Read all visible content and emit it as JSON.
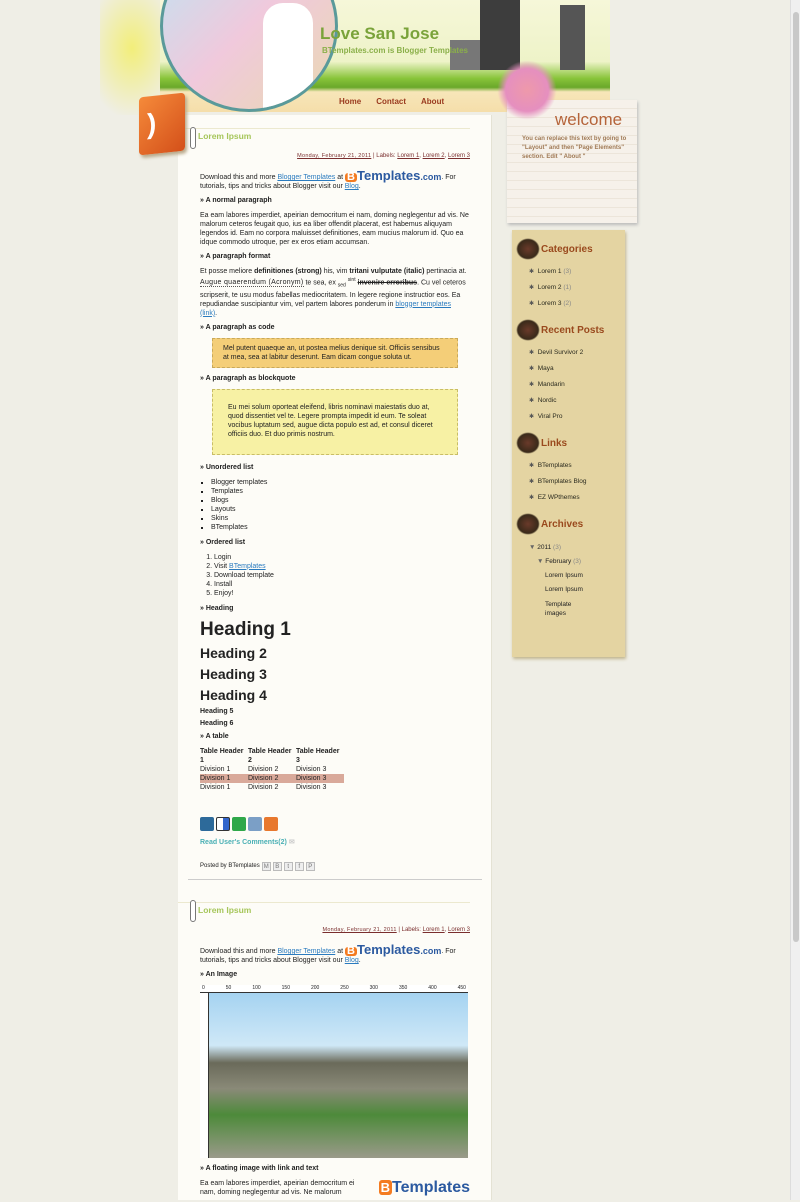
{
  "header": {
    "title": "Love San Jose",
    "description": "BTemplates.com is Blogger Templates",
    "nav": [
      "Home",
      "Contact",
      "About"
    ]
  },
  "welcome": {
    "title": "welcome",
    "text": "You can replace this text by going to \"Layout\" and then \"Page Elements\" section. Edit \" About \""
  },
  "sidebar": {
    "categories": {
      "title": "Categories",
      "items": [
        {
          "label": "Lorem 1",
          "count": "(3)"
        },
        {
          "label": "Lorem 2",
          "count": "(1)"
        },
        {
          "label": "Lorem 3",
          "count": "(2)"
        }
      ]
    },
    "recent": {
      "title": "Recent Posts",
      "items": [
        "Devil Survivor 2",
        "Maya",
        "Mandarin",
        "Nordic",
        "Viral Pro"
      ]
    },
    "links": {
      "title": "Links",
      "items": [
        "BTemplates",
        "BTemplates Blog",
        "EZ WPthemes"
      ]
    },
    "archives": {
      "title": "Archives",
      "year": "2011",
      "year_count": "(3)",
      "month": "February",
      "month_count": "(3)",
      "posts": [
        "Lorem Ipsum",
        "Lorem Ipsum",
        "Template images"
      ]
    }
  },
  "post1": {
    "title": "Lorem Ipsum",
    "date": "Monday, February 21, 2011",
    "labels_prefix": "| Labels:",
    "labels": [
      "Lorem 1",
      "Lorem 2",
      "Lorem 3"
    ],
    "intro_a": "Download this and more ",
    "intro_link": "Blogger Templates",
    "intro_b": " at ",
    "logo_b": "B",
    "logo_text": "Templates",
    "logo_com": ".com",
    "intro_c": ". For tutorials, tips and tricks about Blogger visit our ",
    "blog_link": "Blog",
    "intro_d": ".",
    "h_normal": "» A normal paragraph",
    "normal": "Ea eam labores imperdiet, apeirian democritum ei nam, doming neglegentur ad vis. Ne malorum ceteros feugait quo, ius ea liber offendit placerat, est habemus aliquyam legendos id. Eam no corpora maluisset definitiones, eam mucius malorum id. Quo ea idque commodo utroque, per ex eros etiam accumsan.",
    "h_format": "» A paragraph format",
    "fmt": {
      "a": "Et posse meliore ",
      "strong": "definitiones (strong)",
      "b": " his, vim ",
      "italic": "tritani vulputate (italic)",
      "c": " pertinacia at. ",
      "acronym": "Augue quaerendum (Acronym)",
      "d": " te sea, ex ",
      "sub": "sed",
      "sup": "sint",
      "strike": "invenire erroribus",
      "e": ". Cu vel ceteros scripserit, te usu modus fabellas mediocritatem. In legere regione instructior eos. Ea repudiandae suscipiantur vim, vel partem labores ponderum in ",
      "link": "blogger templates (link)",
      "f": "."
    },
    "h_code": "» A paragraph as code",
    "code": "Mel putent quaeque an, ut postea melius denique sit. Officiis sensibus at mea, sea at labitur deserunt. Eam dicam congue soluta ut.",
    "h_quote": "» A paragraph as blockquote",
    "quote": "Eu mei solum oporteat eleifend, libris nominavi maiestatis duo at, quod dissentiet vel te. Legere prompta impedit id eum. Te soleat vocibus luptatum sed, augue dicta populo est ad, et consul diceret officiis duo. Et duo primis nostrum.",
    "h_ul": "» Unordered list",
    "ul": [
      "Blogger templates",
      "Templates",
      "Blogs",
      "Layouts",
      "Skins",
      "BTemplates"
    ],
    "h_ol": "» Ordered list",
    "ol": [
      "Login",
      "Visit ",
      "Download template",
      "Install",
      "Enjoy!"
    ],
    "ol_link": "BTemplates",
    "h_heading": "» Heading",
    "headings": [
      "Heading 1",
      "Heading 2",
      "Heading 3",
      "Heading 4",
      "Heading 5",
      "Heading 6"
    ],
    "h_table": "» A table",
    "table": {
      "headers": [
        "Table Header 1",
        "Table Header 2",
        "Table Header 3"
      ],
      "rows": [
        [
          "Division 1",
          "Division 2",
          "Division 3"
        ],
        [
          "Division 1",
          "Division 2",
          "Division 3"
        ],
        [
          "Division 1",
          "Division 2",
          "Division 3"
        ]
      ]
    },
    "comments": "Read User's Comments(2)",
    "posted_by": "Posted by BTemplates"
  },
  "post2": {
    "title": "Lorem Ipsum",
    "date": "Monday, February 21, 2011",
    "labels_prefix": "| Labels:",
    "labels": [
      "Lorem 1",
      "Lorem 3"
    ],
    "h_image": "» An Image",
    "ruler": [
      "0",
      "50",
      "100",
      "150",
      "200",
      "250",
      "300",
      "350",
      "400",
      "450"
    ],
    "h_float": "» A floating image with link and text",
    "float_text": "Ea eam labores imperdiet, apeirian democritum ei nam, doming neglegentur ad vis. Ne malorum"
  }
}
